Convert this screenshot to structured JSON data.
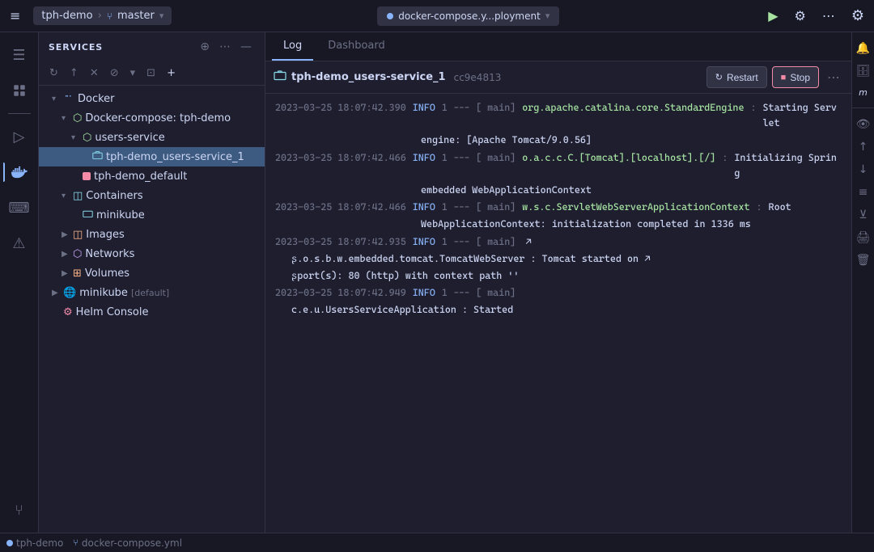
{
  "titlebar": {
    "repo": "tph-demo",
    "branch": "master",
    "file": "docker-compose.y...ployment"
  },
  "sidebar": {
    "title": "Services",
    "tree": {
      "docker_label": "Docker",
      "compose_label": "Docker-compose: tph-demo",
      "service_label": "users-service",
      "container_label": "tph-demo_users-service_1",
      "default_network_label": "tph-demo_default",
      "containers_label": "Containers",
      "minikube_container_label": "minikube",
      "images_label": "Images",
      "networks_label": "Networks",
      "volumes_label": "Volumes",
      "minikube_node_label": "minikube",
      "minikube_suffix": "[default]",
      "helm_label": "Helm Console"
    }
  },
  "log_panel": {
    "tab_log": "Log",
    "tab_dashboard": "Dashboard",
    "container_icon": "▣",
    "container_name": "tph-demo_users-service_1",
    "container_id": "cc9e4813",
    "restart_label": "Restart",
    "stop_label": "Stop",
    "logs": [
      {
        "timestamp": "2023-03-25 18:07:42.390",
        "level": "INFO",
        "thread": "1",
        "bracket": "---",
        "thread_name": "[           main]",
        "logger": "org.apache.catalina.core.StandardEngine",
        "separator": ":",
        "message": "Starting Servlet"
      },
      {
        "continuation": "engine: [Apache Tomcat/9.0.56]"
      },
      {
        "timestamp": "2023-03-25 18:07:42.466",
        "level": "INFO",
        "thread": "1",
        "bracket": "---",
        "thread_name": "[           main]",
        "logger": "o.a.c.c.C.[Tomcat].[localhost].[/]",
        "separator": ":",
        "message": "Initializing Spring"
      },
      {
        "continuation": "embedded WebApplicationContext"
      },
      {
        "timestamp": "2023-03-25 18:07:42.466",
        "level": "INFO",
        "thread": "1",
        "bracket": "---",
        "thread_name": "[           main]",
        "logger": "w.s.c.ServletWebServerApplicationContext",
        "separator": ":",
        "message": "Root"
      },
      {
        "continuation": "WebApplicationContext: initialization completed in 1336 ms"
      },
      {
        "timestamp": "2023-03-25 18:07:42.935",
        "level": "INFO",
        "thread": "1",
        "bracket": "---",
        "thread_name": "[           main]",
        "logger": "",
        "separator": "",
        "message": "↗",
        "special": true
      },
      {
        "continuation": "ʂ.o.s.b.w.embedded.tomcat.TomcatWebServer  : Tomcat started on ↗"
      },
      {
        "continuation": "ʂport(s): 80 (http) with context path ''"
      },
      {
        "timestamp": "2023-03-25 18:07:42.949",
        "level": "INFO",
        "thread": "1",
        "bracket": "---",
        "thread_name": "[           main]",
        "logger": "",
        "separator": "",
        "message": ""
      },
      {
        "continuation": "c.e.u.UsersServiceApplication           : Started"
      }
    ]
  },
  "statusbar": {
    "repo": "tph-demo",
    "file": "docker-compose.yml"
  }
}
